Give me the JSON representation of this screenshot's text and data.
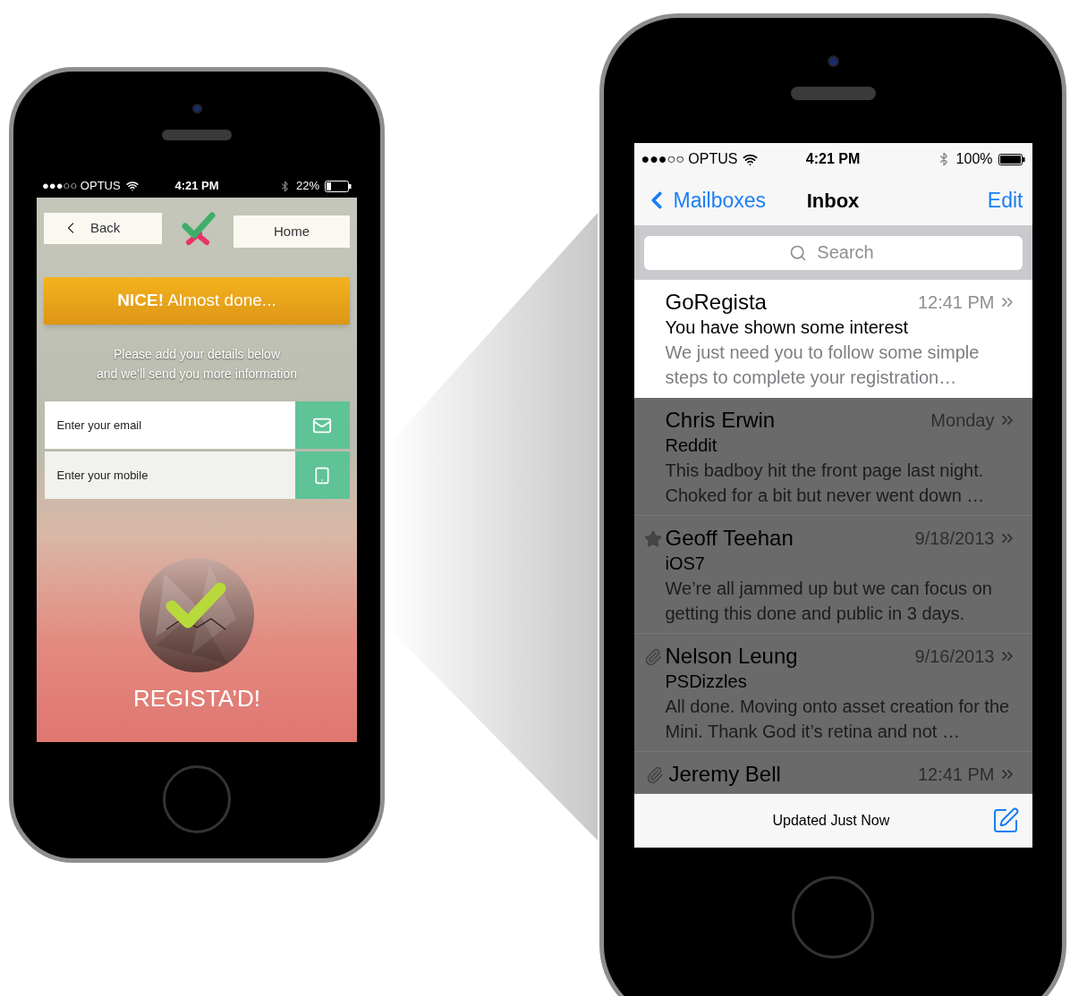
{
  "left_phone": {
    "status_bar": {
      "carrier": "●●●○○ OPTUS",
      "time": "4:21 PM",
      "battery": "22%"
    },
    "nav": {
      "back": "Back",
      "home": "Home"
    },
    "banner": "**NICE!** Almost done...",
    "intro": [
      "Please add your details below",
      "and we’ll send you more information"
    ],
    "fields": [
      {
        "kind": "email",
        "placeholder": "Enter your email",
        "focused": true
      },
      {
        "kind": "mobile",
        "placeholder": "Enter your mobile",
        "focused": false
      }
    ],
    "status": "REGISTA’D!"
  },
  "right_phone": {
    "status_bar": {
      "carrier": "●●●○○ OPTUS",
      "time": "4:21 PM",
      "battery": "100%"
    },
    "nav": {
      "back": "Mailboxes",
      "title": "Inbox",
      "action": "Edit"
    },
    "search": {
      "placeholder": "Search"
    },
    "messages": [
      {
        "sender": "GoRegista",
        "date": "12:41 PM",
        "subject": "You have shown some interest",
        "preview": "We just need you to follow some simple steps to complete your registration…",
        "highlighted": true,
        "starred": false,
        "attachment": false
      },
      {
        "sender": "Chris Erwin",
        "date": "Monday",
        "subject": "Reddit",
        "preview": "This badboy hit the front page last night. Choked for a bit but never went down …",
        "highlighted": false,
        "starred": false,
        "attachment": false
      },
      {
        "sender": "Geoff Teehan",
        "date": "9/18/2013",
        "subject": "iOS7",
        "preview": "We’re all jammed up but we can focus on getting this done and public in 3 days.",
        "highlighted": false,
        "starred": true,
        "attachment": false
      },
      {
        "sender": "Nelson Leung",
        "date": "9/16/2013",
        "subject": "PSDizzles",
        "preview": "All done. Moving onto asset creation for the Mini. Thank God it’s retina and not …",
        "highlighted": false,
        "starred": false,
        "attachment": true
      },
      {
        "sender": "Jeremy Bell",
        "date": "12:41 PM",
        "highlighted": false,
        "starred": false,
        "attachment": true
      }
    ],
    "toolbar": {
      "status": "Updated Just Now"
    }
  }
}
